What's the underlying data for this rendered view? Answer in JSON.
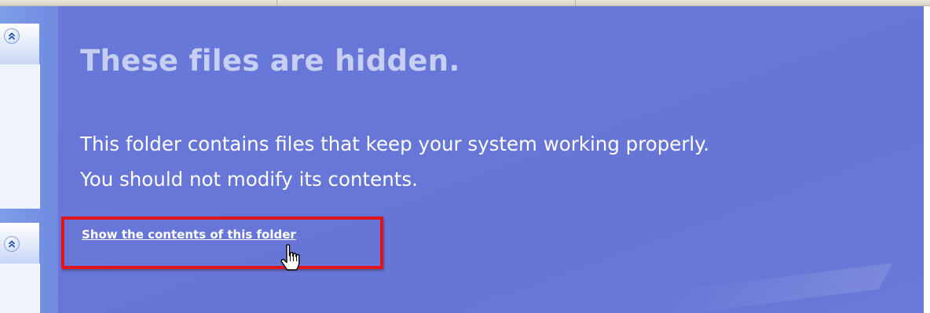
{
  "folder_notice": {
    "heading": "These files are hidden.",
    "message_lines": [
      "This folder contains files that keep your system working properly.",
      "You should not modify its contents."
    ],
    "show_link": "Show the contents of this folder"
  },
  "task_pane": {
    "groups": [
      {
        "icon": "chevron-up-double-icon",
        "state": "expanded"
      },
      {
        "icon": "chevron-up-double-icon",
        "state": "expanded"
      }
    ]
  },
  "colors": {
    "content_background": "#6776d6",
    "heading_text": "#c6cff2",
    "body_text": "#ffffff",
    "highlight_border": "#e0141a",
    "task_pane_background": "#7e9ee8"
  }
}
